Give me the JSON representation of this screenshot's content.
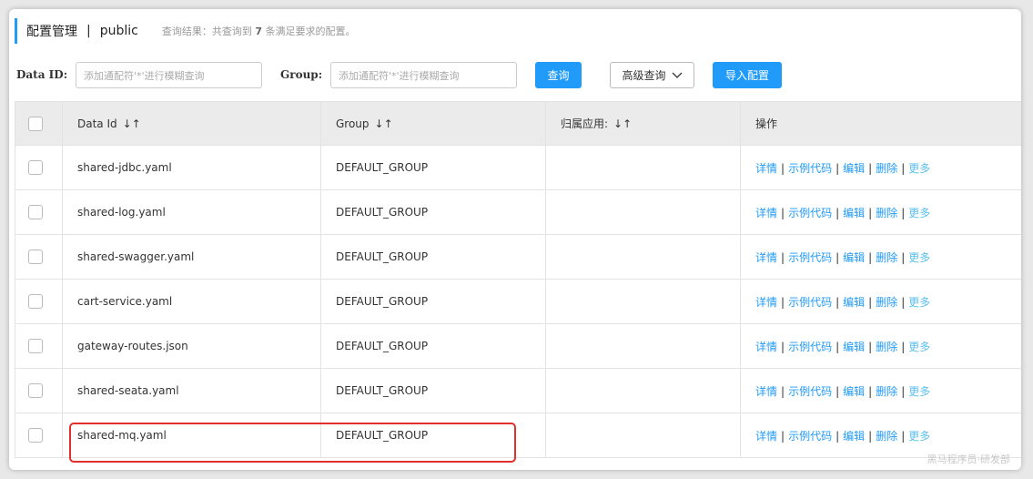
{
  "header": {
    "title": "配置管理",
    "separator": "|",
    "namespace": "public",
    "result_prefix": "查询结果：共查询到",
    "result_count": "7",
    "result_suffix": "条满足要求的配置。"
  },
  "search": {
    "dataid_label": "Data ID:",
    "dataid_placeholder": "添加通配符'*'进行模糊查询",
    "group_label": "Group:",
    "group_placeholder": "添加通配符'*'进行模糊查询",
    "query_button": "查询",
    "advanced_button": "高级查询",
    "import_button": "导入配置"
  },
  "table": {
    "columns": [
      "Data Id",
      "Group",
      "归属应用:",
      "操作"
    ],
    "sort_glyph": "↓↑",
    "actions": [
      "详情",
      "示例代码",
      "编辑",
      "删除",
      "更多"
    ],
    "action_separator": "|",
    "rows": [
      {
        "data_id": "shared-jdbc.yaml",
        "group": "DEFAULT_GROUP",
        "app": ""
      },
      {
        "data_id": "shared-log.yaml",
        "group": "DEFAULT_GROUP",
        "app": ""
      },
      {
        "data_id": "shared-swagger.yaml",
        "group": "DEFAULT_GROUP",
        "app": ""
      },
      {
        "data_id": "cart-service.yaml",
        "group": "DEFAULT_GROUP",
        "app": ""
      },
      {
        "data_id": "gateway-routes.json",
        "group": "DEFAULT_GROUP",
        "app": ""
      },
      {
        "data_id": "shared-seata.yaml",
        "group": "DEFAULT_GROUP",
        "app": ""
      },
      {
        "data_id": "shared-mq.yaml",
        "group": "DEFAULT_GROUP",
        "app": ""
      }
    ]
  },
  "watermark": "黑马程序员·研发部",
  "colors": {
    "primary": "#209bfa",
    "highlight": "#e0302c",
    "header_bg": "#ebebeb"
  }
}
